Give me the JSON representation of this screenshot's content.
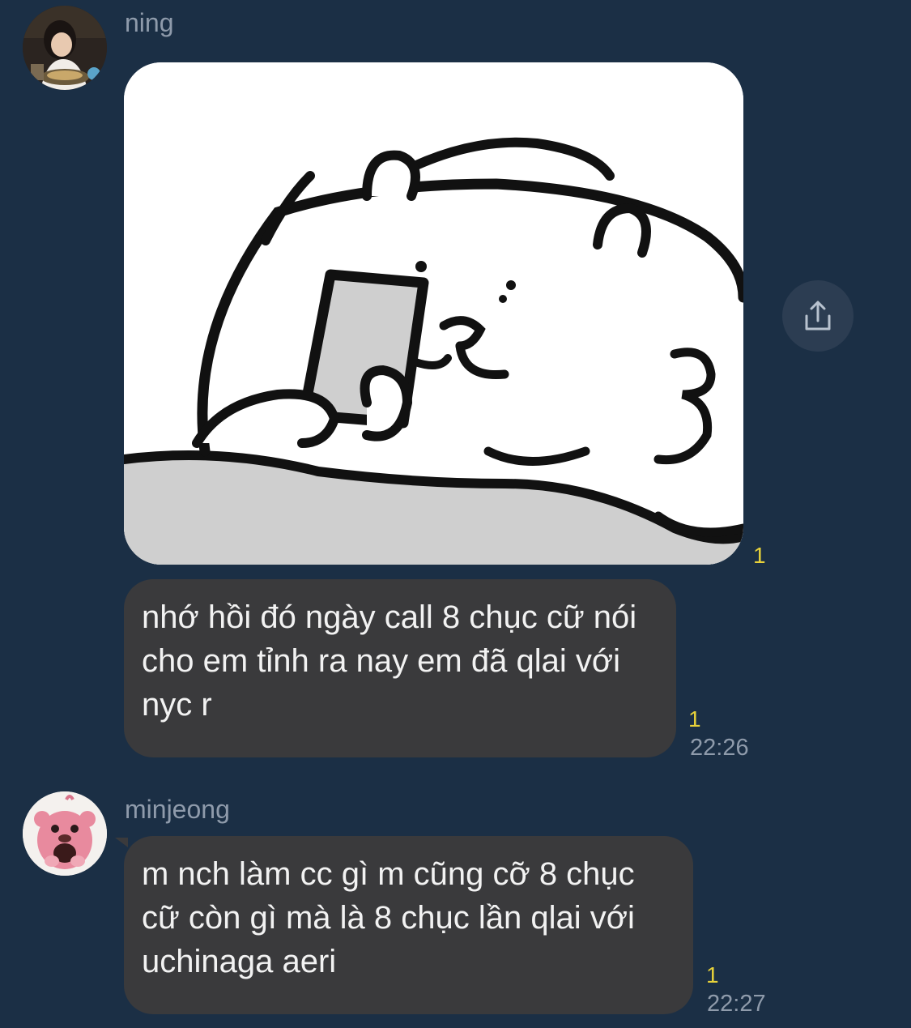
{
  "messages": [
    {
      "sender": "ning",
      "sticker": "bear-holding-phone-sticker",
      "read_count": "1"
    },
    {
      "sender": "ning",
      "text": "nhớ hồi đó ngày call 8 chục cữ nói cho em tỉnh ra nay em đã qlai với nyc r",
      "read_count": "1",
      "time": "22:26"
    },
    {
      "sender": "minjeong",
      "text": "m nch làm cc gì m cũng cỡ 8 chục cữ còn gì mà là 8 chục lần qlai với uchinaga aeri",
      "read_count": "1",
      "time": "22:27"
    }
  ],
  "icons": {
    "share": "share-icon"
  },
  "colors": {
    "background": "#1b2f45",
    "bubble": "#3a3a3c",
    "read_count": "#e8d23a",
    "meta_text": "#8f9bab"
  }
}
